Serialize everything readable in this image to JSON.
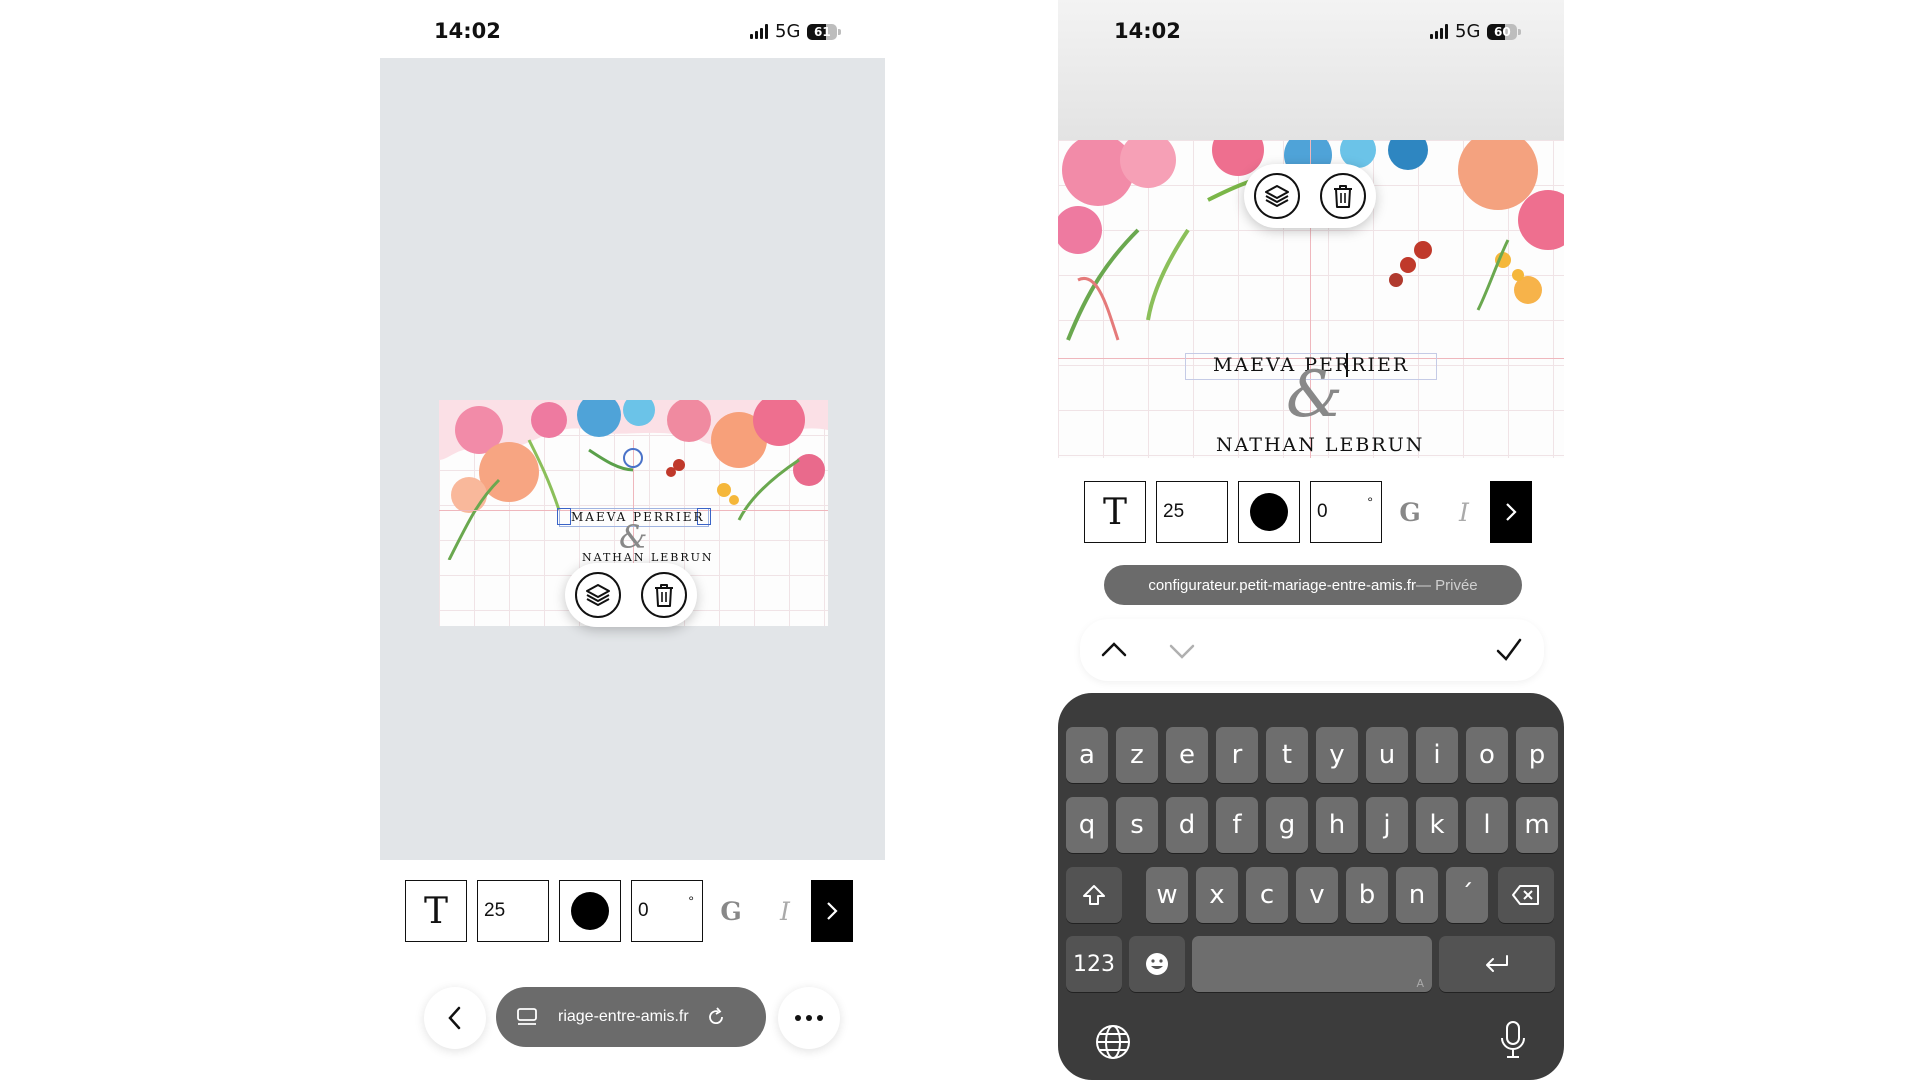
{
  "left": {
    "status": {
      "time": "14:02",
      "network": "5G",
      "battery": "61"
    },
    "card": {
      "name1": "MAEVA  PERRIER",
      "name2": "NATHAN LEBRUN",
      "monogram": "&"
    },
    "toolbar": {
      "font_size": "25",
      "rotation": "0",
      "degree": "°",
      "bold_label": "G",
      "italic_label": "I"
    },
    "url_bar": {
      "text": "riage-entre-amis.fr"
    }
  },
  "right": {
    "status": {
      "time": "14:02",
      "network": "5G",
      "battery": "60"
    },
    "card": {
      "name1": "MAEVA  PERRIER",
      "name2": "NATHAN LEBRUN",
      "monogram": "&"
    },
    "toolbar": {
      "font_size": "25",
      "rotation": "0",
      "degree": "°",
      "bold_label": "G",
      "italic_label": "I"
    },
    "url_tooltip": {
      "domain": "configurateur.petit-mariage-entre-amis.fr",
      "suffix": " — Privée"
    },
    "keyboard": {
      "row1": [
        "a",
        "z",
        "e",
        "r",
        "t",
        "y",
        "u",
        "i",
        "o",
        "p"
      ],
      "row2": [
        "q",
        "s",
        "d",
        "f",
        "g",
        "h",
        "j",
        "k",
        "l",
        "m"
      ],
      "row3": [
        "w",
        "x",
        "c",
        "v",
        "b",
        "n",
        "´"
      ],
      "numbers_key": "123",
      "space_hint": "A"
    }
  },
  "colors": {
    "canvas_bg": "#e2e5e8",
    "keyboard_bg": "#3c3c3c",
    "key_bg": "#6e6e6e",
    "guide": "#efb7bd"
  }
}
